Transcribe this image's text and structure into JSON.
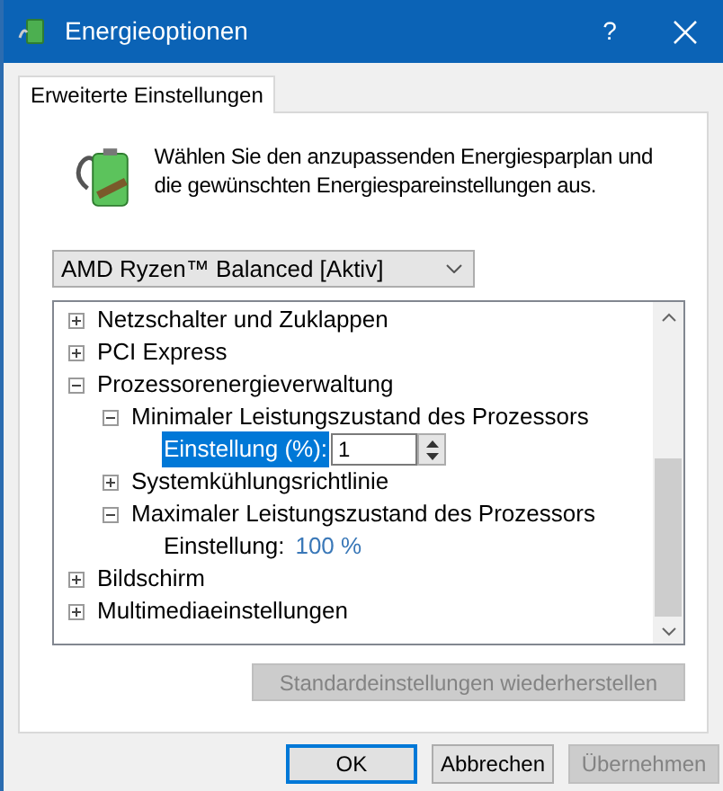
{
  "window": {
    "title": "Energieoptionen",
    "help": "?"
  },
  "tabs": [
    {
      "label": "Erweiterte Einstellungen",
      "selected": true
    }
  ],
  "intro": "Wählen Sie den anzupassenden Energiesparplan und die gewünschten Energiespareinstellungen aus.",
  "plan_dropdown": {
    "value": "AMD Ryzen™ Balanced [Aktiv]"
  },
  "tree": [
    {
      "kind": "node",
      "label": "Netzschalter und Zuklappen",
      "expanded": false
    },
    {
      "kind": "node",
      "label": "PCI Express",
      "expanded": false
    },
    {
      "kind": "node",
      "label": "Prozessorenergieverwaltung",
      "expanded": true,
      "children": [
        {
          "kind": "node",
          "label": "Minimaler Leistungszustand des Prozessors",
          "expanded": true,
          "children": [
            {
              "kind": "spin",
              "label": "Einstellung (%):",
              "value": "1",
              "selected": true
            }
          ]
        },
        {
          "kind": "node",
          "label": "Systemkühlungsrichtlinie",
          "expanded": false
        },
        {
          "kind": "node",
          "label": "Maximaler Leistungszustand des Prozessors",
          "expanded": true,
          "children": [
            {
              "kind": "value",
              "label": "Einstellung:",
              "value": "100 %",
              "selected": false
            }
          ]
        }
      ]
    },
    {
      "kind": "node",
      "label": "Bildschirm",
      "expanded": false
    },
    {
      "kind": "node",
      "label": "Multimediaeinstellungen",
      "expanded": false
    }
  ],
  "restore_button": {
    "label": "Standardeinstellungen wiederherstellen",
    "disabled": true
  },
  "buttons": [
    {
      "label": "OK",
      "disabled": false,
      "default": true
    },
    {
      "label": "Abbrechen",
      "disabled": false,
      "default": false
    },
    {
      "label": "Übernehmen",
      "disabled": true,
      "default": false
    }
  ]
}
